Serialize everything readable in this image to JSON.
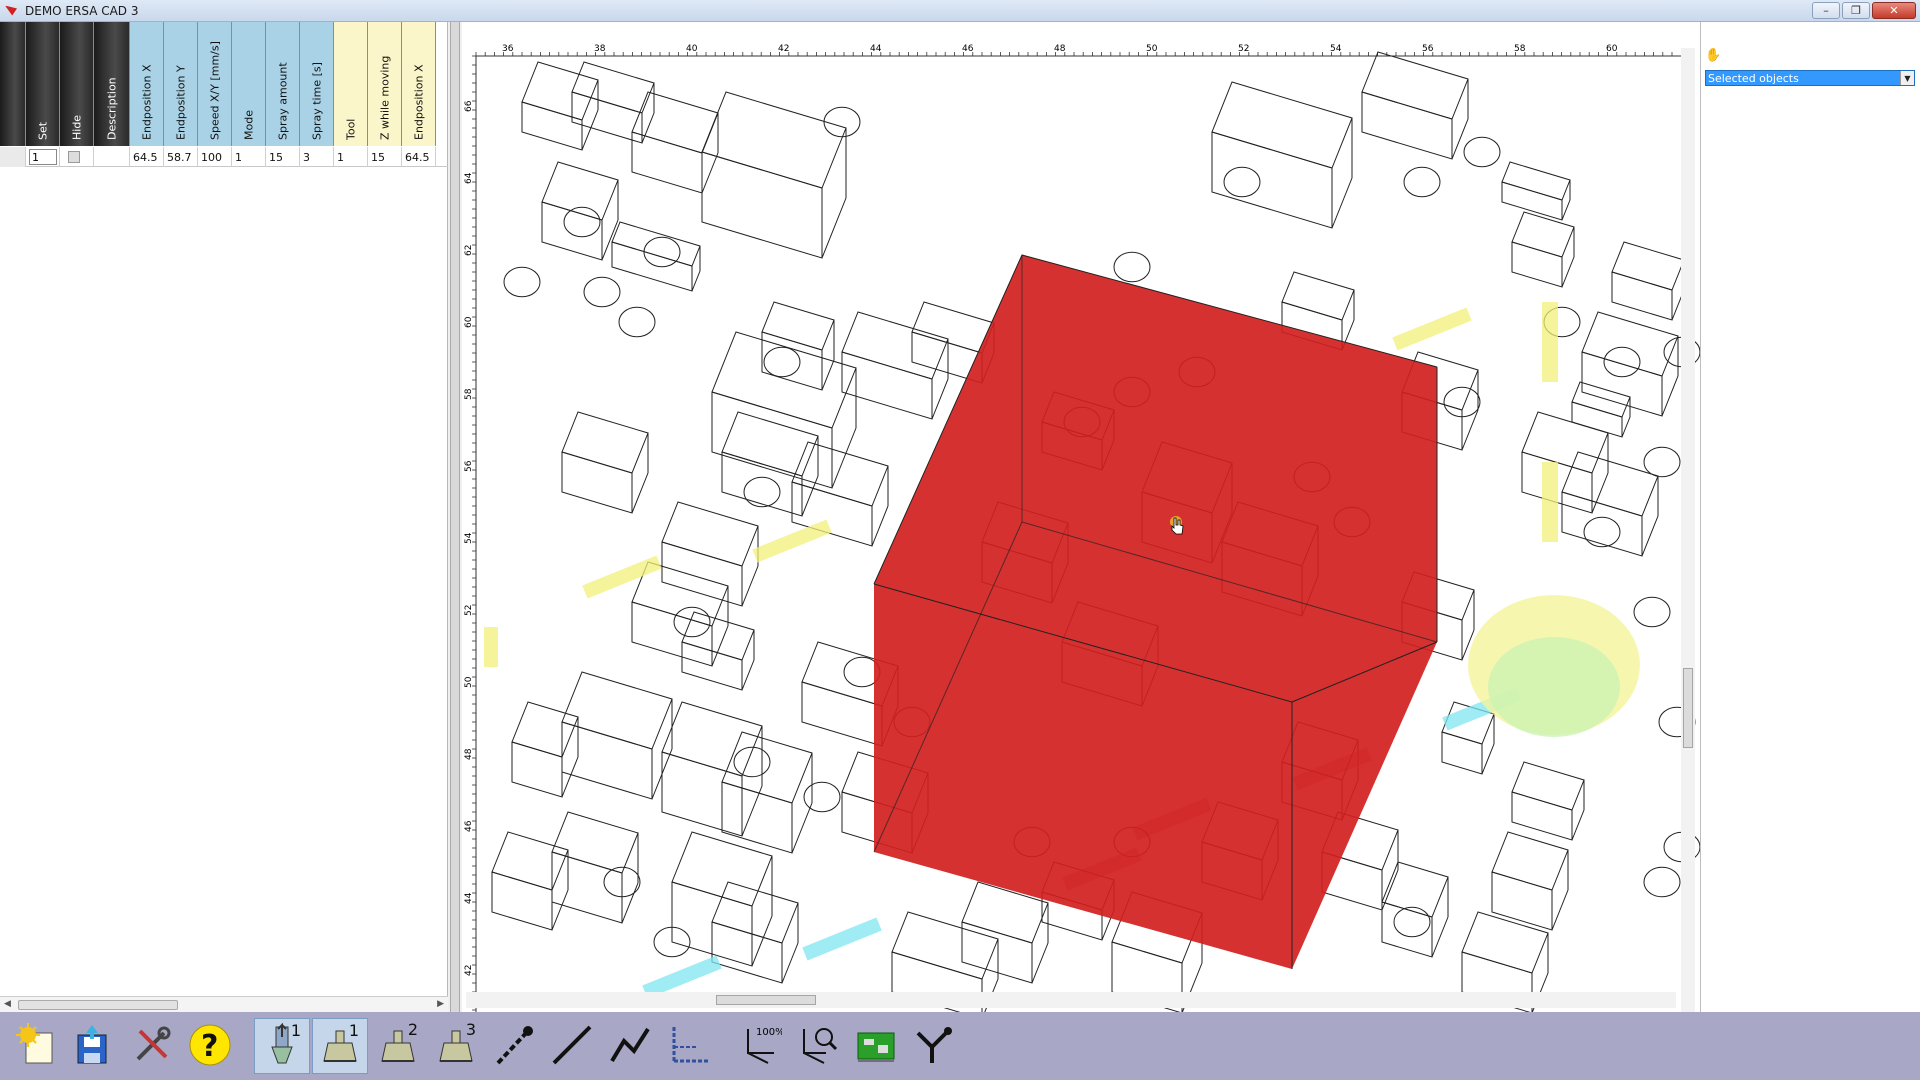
{
  "window": {
    "title": "DEMO  ERSA CAD 3",
    "controls": [
      "minimize",
      "restore",
      "close"
    ]
  },
  "grid": {
    "columns": [
      {
        "label": "",
        "style": "dark"
      },
      {
        "label": "Set",
        "style": "dark"
      },
      {
        "label": "Hide",
        "style": "dark"
      },
      {
        "label": "Description",
        "style": "dark"
      },
      {
        "label": "Endposition X",
        "style": "blue"
      },
      {
        "label": "Endposition Y",
        "style": "blue"
      },
      {
        "label": "Speed X/Y [mm/s]",
        "style": "blue"
      },
      {
        "label": "Mode",
        "style": "blue"
      },
      {
        "label": "Spray amount",
        "style": "blue"
      },
      {
        "label": "Spray time [s]",
        "style": "blue"
      },
      {
        "label": "Tool",
        "style": "yellow"
      },
      {
        "label": "Z while moving",
        "style": "yellow"
      },
      {
        "label": "Endposition X",
        "style": "yellow"
      }
    ],
    "rows": [
      {
        "set": "1",
        "hide": false,
        "description": "",
        "end_x": "64.5",
        "end_y": "58.7",
        "speed": "100",
        "mode": "1",
        "spray_amount": "15",
        "spray_time": "3",
        "tool": "1",
        "z_moving": "15",
        "end_x2": "64.5"
      }
    ]
  },
  "ruler": {
    "top_labels": [
      "36",
      "38",
      "40",
      "42",
      "44",
      "46",
      "48",
      "50",
      "52",
      "54",
      "56",
      "58",
      "60"
    ],
    "left_labels": [
      "66",
      "64",
      "62",
      "60",
      "58",
      "56",
      "54",
      "52",
      "50",
      "48",
      "46",
      "44",
      "42"
    ]
  },
  "right_panel": {
    "selector_value": "Selected objects",
    "icon": "selection-hand-icon"
  },
  "toolbar": {
    "buttons": [
      {
        "name": "new-project-button",
        "icon": "sun-document-icon"
      },
      {
        "name": "save-button",
        "icon": "floppy-upload-icon"
      },
      {
        "name": "tools-button",
        "icon": "wrench-screwdriver-icon"
      },
      {
        "name": "help-button",
        "icon": "question-icon"
      },
      {
        "name": "spray-tool-1-button",
        "icon": "spray-nozzle-icon",
        "badge": "1"
      },
      {
        "name": "tool-1-button",
        "icon": "nozzle-icon",
        "badge": "1"
      },
      {
        "name": "tool-2-button",
        "icon": "nozzle-icon",
        "badge": "2"
      },
      {
        "name": "tool-3-button",
        "icon": "nozzle-icon",
        "badge": "3"
      },
      {
        "name": "point-tool-button",
        "icon": "point-line-icon"
      },
      {
        "name": "line-tool-button",
        "icon": "line-icon"
      },
      {
        "name": "polyline-tool-button",
        "icon": "polyline-icon"
      },
      {
        "name": "axis-view-button",
        "icon": "axis-icon"
      },
      {
        "name": "zoom-100-button",
        "icon": "zoom-axis-icon",
        "badge": "100%"
      },
      {
        "name": "zoom-view-button",
        "icon": "zoom-magnifier-icon"
      },
      {
        "name": "board-view-button",
        "icon": "pcb-board-icon"
      },
      {
        "name": "path-tool-button",
        "icon": "path-pointer-icon"
      }
    ]
  },
  "colors": {
    "selected_box": "#d21f1f",
    "spray_yellow": "#f3f07a",
    "spray_cyan": "#7fe6f0",
    "dark_red_marks": "#9a2a2a"
  }
}
